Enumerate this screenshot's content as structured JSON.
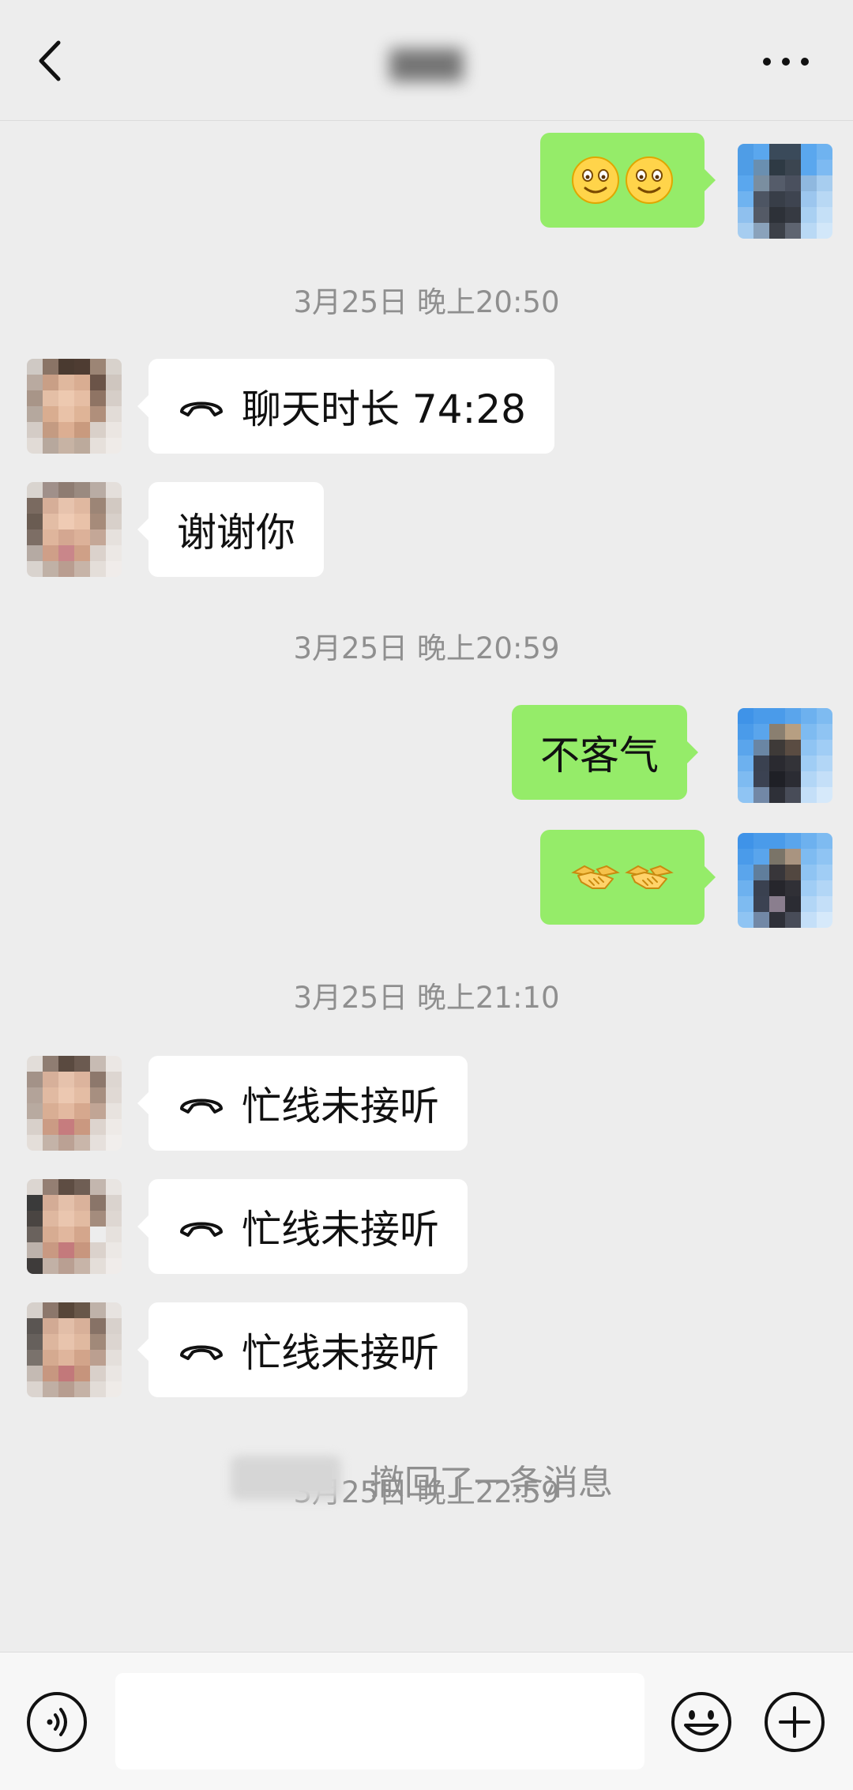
{
  "header": {
    "title": "▇▇▇",
    "back_icon": "chevron-left-icon",
    "more_icon": "more-horizontal-icon"
  },
  "messages": {
    "m1_emoji": [
      "smile-emoji",
      "smile-emoji"
    ],
    "time1": "3月25日 晚上20:50",
    "m2_text": "聊天时长 74:28",
    "m3_text": "谢谢你",
    "time2": "3月25日 晚上20:59",
    "m4_text": "不客气",
    "m5_emoji": [
      "handshake-emoji",
      "handshake-emoji"
    ],
    "time3": "3月25日 晚上21:10",
    "m6_text": "忙线未接听",
    "m7_text": "忙线未接听",
    "m8_text": "忙线未接听",
    "time4": "3月25日 晚上22:59",
    "recall_text": "撤回了一条消息"
  },
  "input": {
    "placeholder": ""
  },
  "colors": {
    "background": "#ededed",
    "sent_bubble": "#95ec69",
    "received_bubble": "#ffffff",
    "timestamp": "#8f8f8f"
  }
}
